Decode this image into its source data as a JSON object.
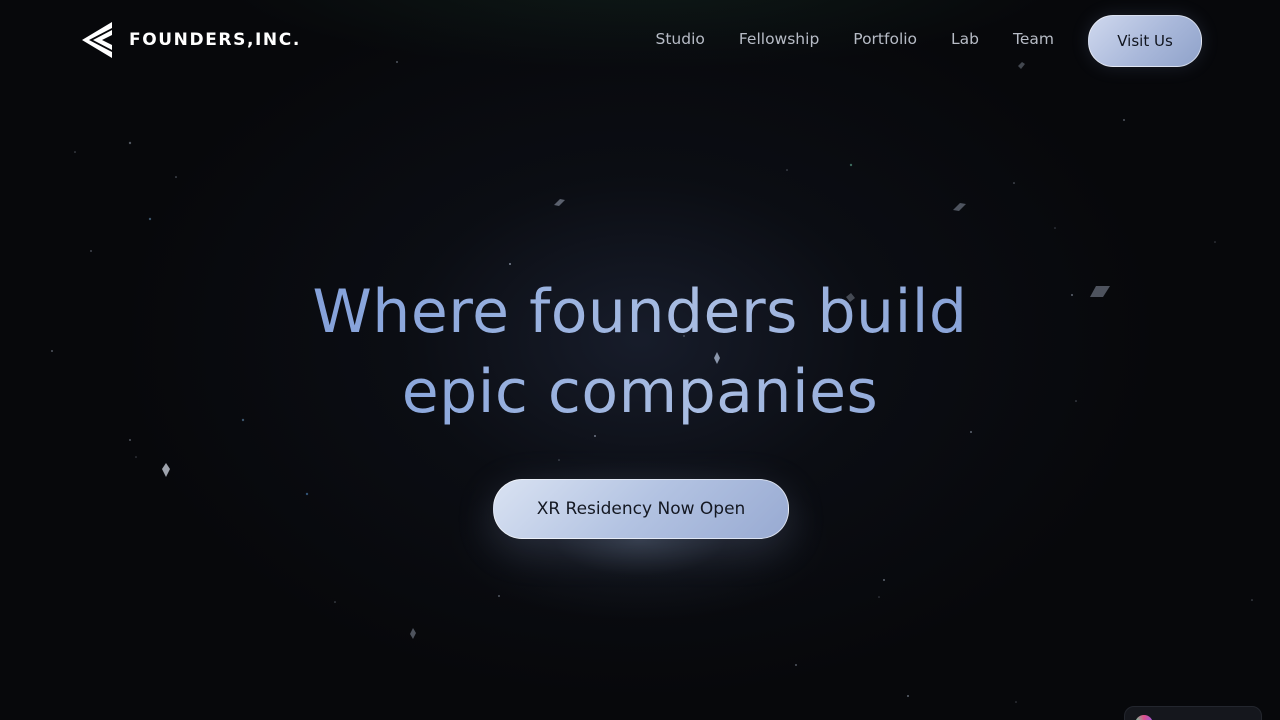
{
  "header": {
    "logo_text": "FOUNDERS,INC.",
    "nav": [
      {
        "label": "Studio"
      },
      {
        "label": "Fellowship"
      },
      {
        "label": "Portfolio"
      },
      {
        "label": "Lab"
      },
      {
        "label": "Team"
      }
    ],
    "cta_label": "Visit Us"
  },
  "hero": {
    "title_line1": "Where founders build",
    "title_line2": "epic companies",
    "cta_label": "XR Residency Now Open"
  },
  "colors": {
    "background": "#07080b",
    "button_fill": "#b3c3e2",
    "title_gradient_start": "#6f8fd0",
    "title_gradient_end": "#a9bde2",
    "nav_text": "#b7bcc6"
  },
  "icons": {
    "logo": "founders-chevron-logo-icon",
    "corner_widget": "gradient-orb-icon"
  }
}
